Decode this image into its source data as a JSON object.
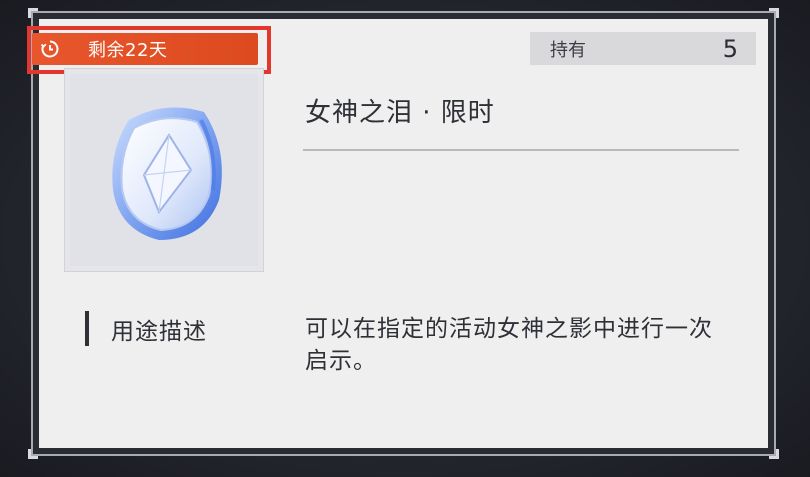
{
  "badge": {
    "icon": "clock-icon",
    "label": "剩余22天",
    "color": "#e8562d"
  },
  "owned": {
    "label": "持有",
    "count": "5"
  },
  "item": {
    "icon": "goddess-tear-gem-icon",
    "name": "女神之泪 · 限时"
  },
  "description": {
    "label": "用途描述",
    "text": "可以在指定的活动女神之影中进行一次启示。"
  }
}
